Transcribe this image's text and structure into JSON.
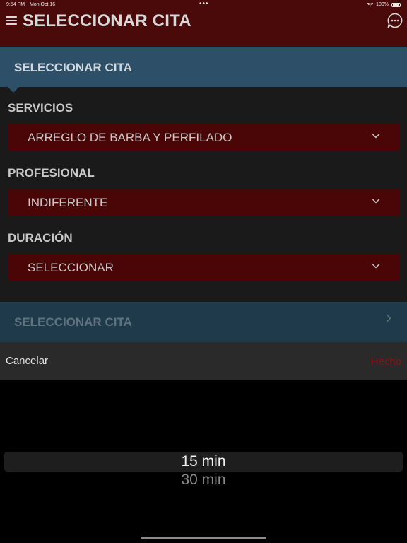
{
  "status_bar": {
    "time": "9:54 PM",
    "date": "Mon Oct 16",
    "dots": "•••",
    "battery": "100%"
  },
  "header": {
    "title": "SELECCIONAR CITA",
    "menu_icon": "hamburger-menu-icon",
    "chat_icon": "chat-bubble-icon"
  },
  "section": {
    "title": "SELECCIONAR CITA"
  },
  "form": {
    "services": {
      "label": "SERVICIOS",
      "value": "ARREGLO DE BARBA  Y PERFILADO"
    },
    "professional": {
      "label": "PROFESIONAL",
      "value": "INDIFERENTE"
    },
    "duration": {
      "label": "DURACIÓN",
      "value": "SELECCIONAR"
    }
  },
  "appointment_button": {
    "label": "SELECCIONAR CITA"
  },
  "picker_toolbar": {
    "cancel": "Cancelar",
    "done": "Hecho"
  },
  "picker": {
    "selected": "15 min",
    "next": "30 min"
  },
  "colors": {
    "header_bg": "#4a0a0a",
    "section_bg": "#2d5068",
    "select_bg": "#4a0606",
    "done_text": "#8b1010"
  }
}
